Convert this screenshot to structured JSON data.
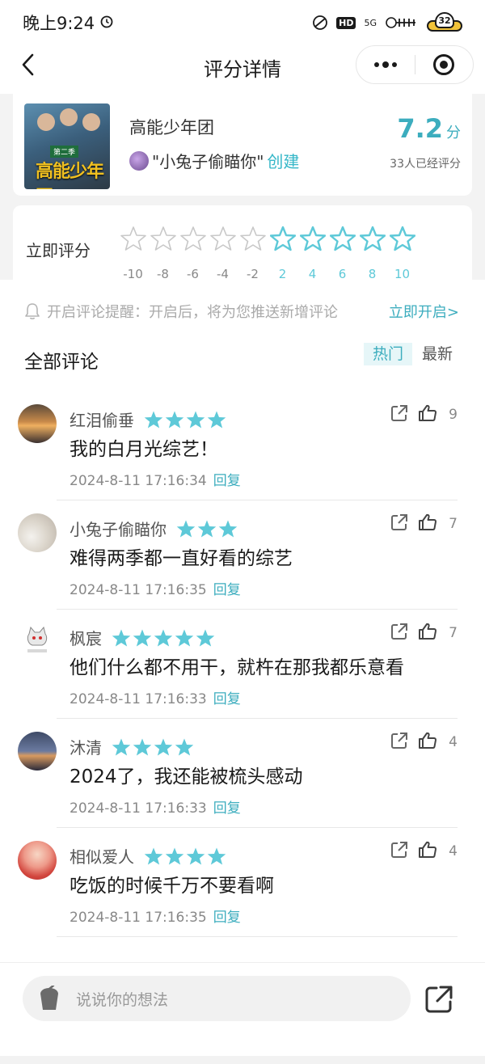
{
  "status_bar": {
    "time": "晚上9:24",
    "hd": "HD",
    "network": "5G",
    "battery_level": "32"
  },
  "nav": {
    "title": "评分详情"
  },
  "show": {
    "name": "高能少年团",
    "creator_quote": "\"小兔子偷瞄你\"",
    "creator_action": "创建",
    "score": "7.2",
    "score_unit": "分",
    "rated_count": "33人已经评分",
    "poster_season": "第二季",
    "poster_logo": "高能少年团"
  },
  "rating": {
    "label": "立即评分",
    "ticks": [
      "-10",
      "-8",
      "-6",
      "-4",
      "-2",
      "2",
      "4",
      "6",
      "8",
      "10"
    ],
    "colors": {
      "negative": "#c8c8c8",
      "positive": "#5ec9d8"
    }
  },
  "notice": {
    "text": "开启评论提醒：开启后，将为您推送新增评论",
    "action": "立即开启>"
  },
  "comments_section": {
    "title": "全部评论",
    "sort_hot": "热门",
    "sort_new": "最新"
  },
  "comments": [
    {
      "user": "红泪偷垂",
      "stars": 4,
      "likes": "9",
      "text": "我的白月光综艺！",
      "time": "2024-8-11 17:16:34",
      "reply": "回复"
    },
    {
      "user": "小兔子偷瞄你",
      "stars": 3,
      "likes": "7",
      "text": "难得两季都一直好看的综艺",
      "time": "2024-8-11 17:16:35",
      "reply": "回复"
    },
    {
      "user": "枫宸",
      "stars": 5,
      "likes": "7",
      "text": "他们什么都不用干，就杵在那我都乐意看",
      "time": "2024-8-11 17:16:33",
      "reply": "回复"
    },
    {
      "user": "沐清",
      "stars": 4,
      "likes": "4",
      "text": "2024了，我还能被梳头感动",
      "time": "2024-8-11 17:16:33",
      "reply": "回复"
    },
    {
      "user": "相似爱人",
      "stars": 4,
      "likes": "4",
      "text": "吃饭的时候千万不要看啊",
      "time": "2024-8-11 17:16:35",
      "reply": "回复"
    }
  ],
  "footer": {
    "input_placeholder": "说说你的想法"
  },
  "colors": {
    "accent": "#3cadbe",
    "star": "#5ec9d8"
  }
}
